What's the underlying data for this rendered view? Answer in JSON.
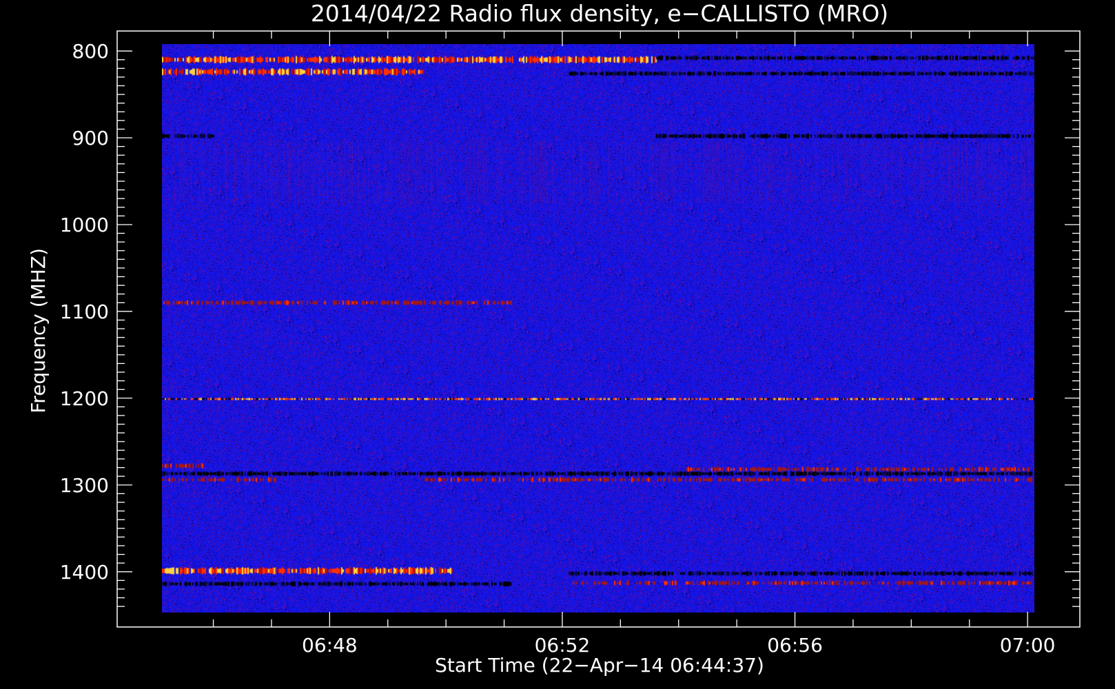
{
  "chart_data": {
    "type": "heatmap",
    "title": "2014/04/22  Radio flux density, e−CALLISTO (MRO)",
    "xlabel": "Start Time (22−Apr−14 06:44:37)",
    "ylabel": "Frequency (MHZ)",
    "x_ticks": [
      "06:48",
      "06:52",
      "06:56",
      "07:00"
    ],
    "y_ticks": [
      "800",
      "900",
      "1000",
      "1100",
      "1200",
      "1300",
      "1400"
    ],
    "x_range_minutes_after_start": [
      0.5,
      15.5
    ],
    "y_range_mhz": [
      792,
      1447
    ],
    "y_reversed": true,
    "colormap": [
      "#000000",
      "#1a1ac8",
      "#2a2aff",
      "#c01010",
      "#ff3000",
      "#ffd040"
    ],
    "features": [
      {
        "label": "band",
        "mhz": 810,
        "t0": 0.5,
        "t1": 9.0,
        "kind": "hot"
      },
      {
        "label": "band",
        "mhz": 824,
        "t0": 0.5,
        "t1": 5.0,
        "kind": "hot"
      },
      {
        "label": "band",
        "mhz": 808,
        "t0": 9.0,
        "t1": 15.5,
        "kind": "dark"
      },
      {
        "label": "band",
        "mhz": 826,
        "t0": 7.5,
        "t1": 15.5,
        "kind": "dark"
      },
      {
        "label": "band",
        "mhz": 898,
        "t0": 0.5,
        "t1": 1.4,
        "kind": "dark"
      },
      {
        "label": "band",
        "mhz": 898,
        "t0": 9.0,
        "t1": 15.5,
        "kind": "dark"
      },
      {
        "label": "band",
        "mhz": 1090,
        "t0": 0.5,
        "t1": 6.5,
        "kind": "warm"
      },
      {
        "label": "band",
        "mhz": 1201,
        "t0": 0.5,
        "t1": 15.5,
        "kind": "line"
      },
      {
        "label": "band",
        "mhz": 1278,
        "t0": 0.5,
        "t1": 1.2,
        "kind": "warm"
      },
      {
        "label": "band",
        "mhz": 1287,
        "t0": 0.5,
        "t1": 15.5,
        "kind": "dark"
      },
      {
        "label": "band",
        "mhz": 1294,
        "t0": 0.5,
        "t1": 2.5,
        "kind": "warm"
      },
      {
        "label": "band",
        "mhz": 1282,
        "t0": 9.5,
        "t1": 15.5,
        "kind": "warm"
      },
      {
        "label": "band",
        "mhz": 1294,
        "t0": 5.0,
        "t1": 15.5,
        "kind": "warm"
      },
      {
        "label": "band",
        "mhz": 1399,
        "t0": 0.5,
        "t1": 5.5,
        "kind": "hot"
      },
      {
        "label": "band",
        "mhz": 1402,
        "t0": 7.5,
        "t1": 15.5,
        "kind": "dark"
      },
      {
        "label": "band",
        "mhz": 1414,
        "t0": 0.5,
        "t1": 6.5,
        "kind": "dark"
      },
      {
        "label": "band",
        "mhz": 1413,
        "t0": 7.5,
        "t1": 15.5,
        "kind": "warm"
      }
    ]
  }
}
